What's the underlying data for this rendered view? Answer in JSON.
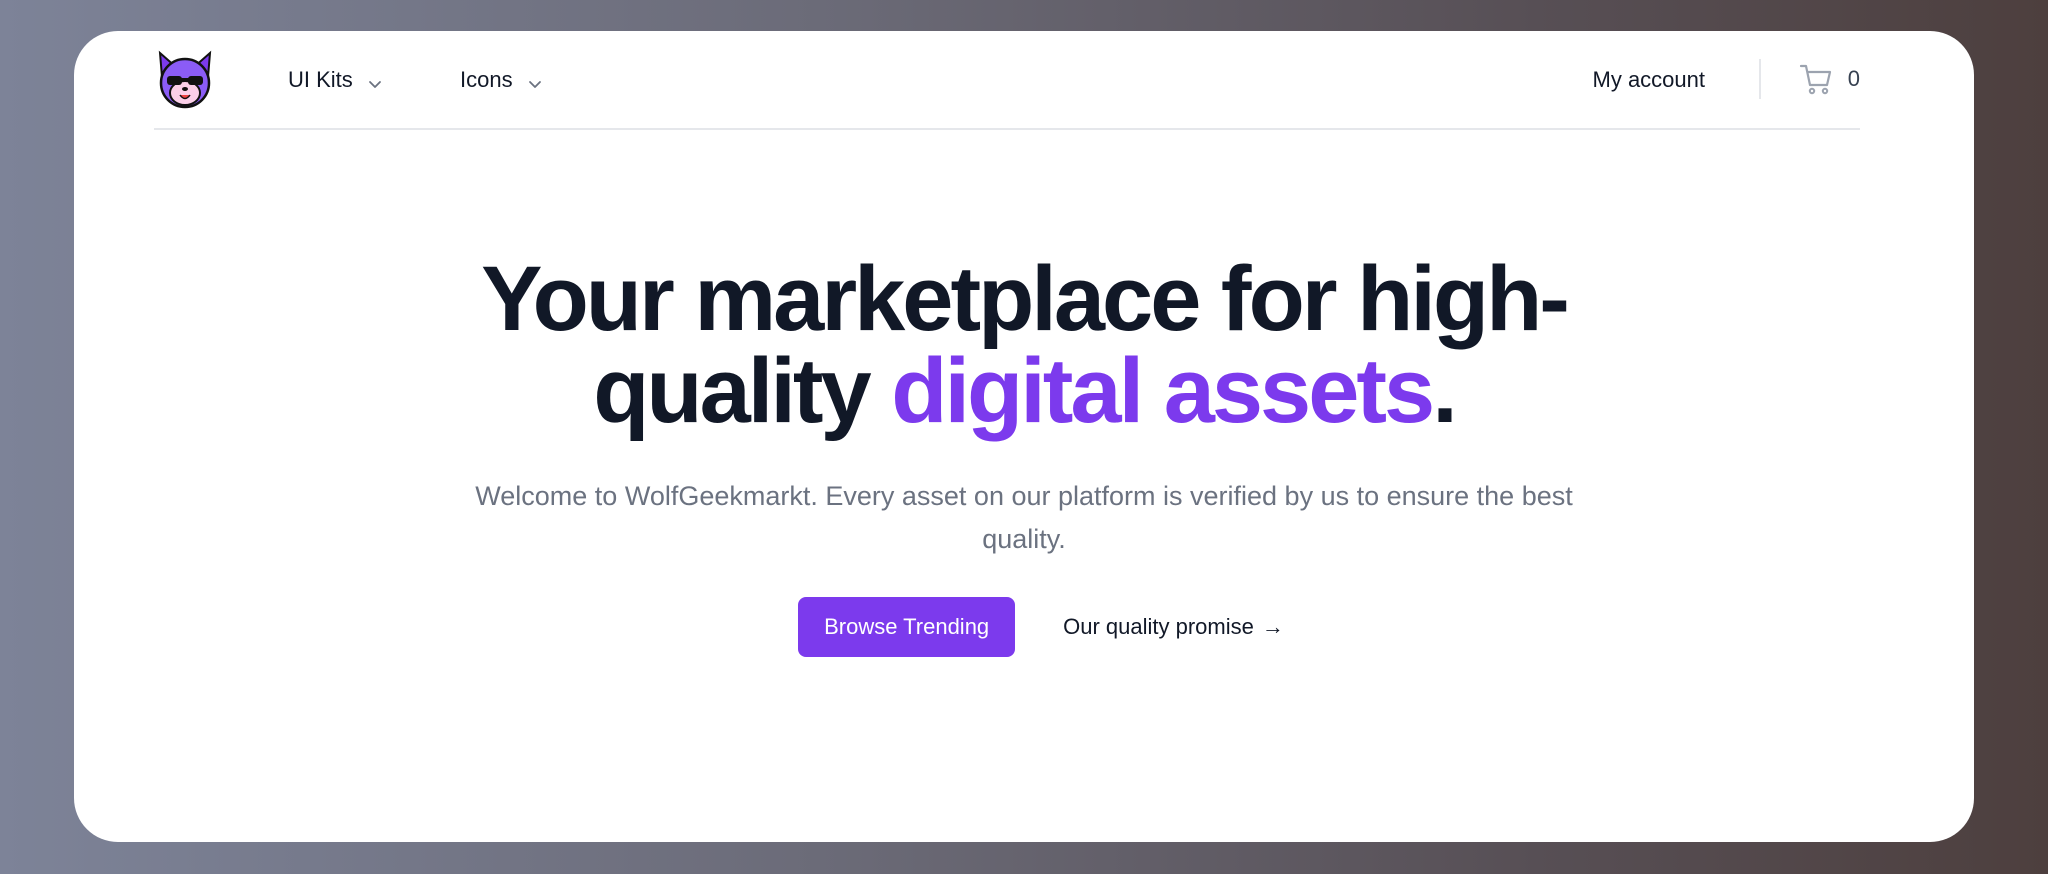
{
  "nav": {
    "logo_icon": "wolf-mascot-logo-icon",
    "items": [
      {
        "label": "UI Kits",
        "icon": "chevron-down-icon"
      },
      {
        "label": "Icons",
        "icon": "chevron-down-icon"
      }
    ],
    "account_label": "My account",
    "cart": {
      "icon": "shopping-cart-icon",
      "count": "0"
    }
  },
  "hero": {
    "headline_line1": "Your marketplace for high-",
    "headline_line2_start": "quality ",
    "headline_accent": "digital assets",
    "headline_end": ".",
    "subtitle": "Welcome to WolfGeekmarkt. Every asset on our platform is verified by us to ensure the best quality.",
    "primary_button": "Browse Trending",
    "secondary_link": "Our quality promise",
    "secondary_arrow": "→"
  },
  "colors": {
    "accent": "#7c3aed",
    "heading": "#111827",
    "muted": "#6b7280"
  }
}
